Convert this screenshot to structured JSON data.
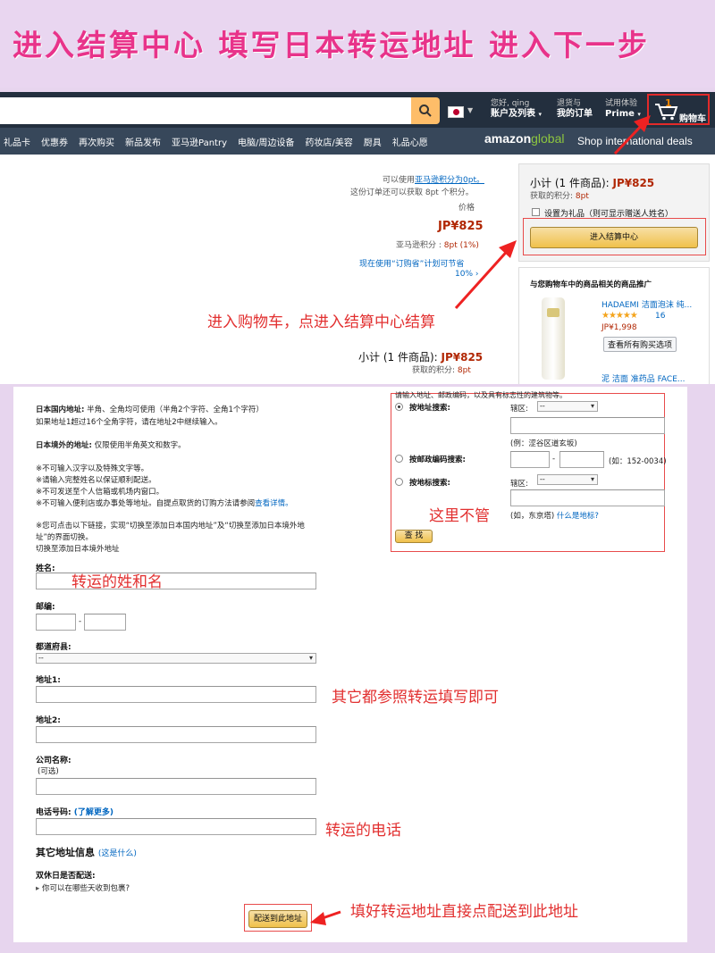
{
  "banner": {
    "title": "进入结算中心 填写日本转运地址 进入下一步"
  },
  "nav": {
    "account_greeting": "您好, qing",
    "account_label": "账户及列表",
    "orders_top": "退货与",
    "orders_label": "我的订单",
    "prime_top": "试用体验",
    "prime_label": "Prime",
    "cart_count": "1",
    "cart_label": "购物车",
    "sub_items": [
      "礼品卡",
      "优惠券",
      "再次购买",
      "新品发布",
      "亚马逊Pantry",
      "电脑/周边设备",
      "药妆店/美容",
      "厨具",
      "礼品心愿"
    ],
    "amazon_text": "amazon",
    "global_text": "global",
    "shop_intl": "Shop international deals"
  },
  "cart": {
    "points_use_text": "可以使用",
    "points_use_link": "亚马逊积分为0pt。",
    "points_earn_note": "这份订单还可以获取 8pt 个积分。",
    "price_header": "价格",
    "item_price": "JP¥825",
    "points_line": "亚马逊积分 :",
    "points_value": "8pt (1%)",
    "save_note": "现在使用“订购省”计划可节省",
    "save_pct": "10% ›",
    "subtotal_label": "小计 (1 件商品):",
    "subtotal_value": "JP¥825",
    "earn_label": "获取的积分:",
    "earn_value": "8pt"
  },
  "sidebar": {
    "subtotal_label": "小计 (1 件商品):",
    "subtotal_value": "JP¥825",
    "earn_label": "获取的积分:",
    "earn_value": "8pt",
    "gift_label": "设置为礼品（则可显示赠送人姓名）",
    "checkout_button": "进入结算中心",
    "promo_title": "与您购物车中的商品相关的商品推广",
    "promo_name": "HADAEMI 洁面泡沫 纯...",
    "promo_rating": 4.5,
    "promo_stars": "★★★★★",
    "promo_reviews": "16",
    "promo_price": "JP¥1,998",
    "promo_see_all": "查看所有购买选项",
    "promo_next": "泥 洁面 准药品 FACE..."
  },
  "annotations": {
    "cart": "进入购物车，点进入结算中心结算",
    "lookup": "这里不管",
    "name": "转运的姓和名",
    "others": "其它都参照转运填写即可",
    "phone": "转运的电话",
    "ship": "填好转运地址直接点配送到此地址"
  },
  "form": {
    "jp_addr_label": "日本国内地址:",
    "jp_addr_rule": "半角、全角均可使用（半角2个字符、全角1个字符）",
    "jp_addr_rule2": "如果地址1超过16个全角字符，请在地址2中继续输入。",
    "intl_addr_label": "日本境外的地址:",
    "intl_addr_rule": "仅限使用半角英文和数字。",
    "notes": [
      "※不可输入汉字以及特殊文字等。",
      "※请输入完整姓名以保证顺利配送。",
      "※不可发送至个人信箱或机场内窗口。",
      "※不可输入便利店或办事处等地址。自提点取货的订购方法请参阅"
    ],
    "notes_link": "查看详情。",
    "switch_note": "※您可点击以下链接，实现“切换至添加日本国内地址”及“切换至添加日本境外地",
    "switch_note2": "址”的界面切换。",
    "switch_link": "切换至添加日本境外地址",
    "name_label": "姓名:",
    "zip_label": "邮编:",
    "zip_dash": "-",
    "pref_label": "都道府县:",
    "pref_value": "--",
    "addr1_label": "地址1:",
    "addr2_label": "地址2:",
    "company_label": "公司名称:",
    "company_optional": "(可选)",
    "phone_label": "电话号码:",
    "phone_more": "(了解更多)",
    "other_info_label": "其它地址信息",
    "other_info_link": "(这是什么)",
    "weekend_label": "双休日是否配送:",
    "weekend_link": "你可以在哪些天收到包裹?",
    "ship_button": "配送到此地址"
  },
  "lookup": {
    "header": "请输入地址、邮政编码，以及具有标志性的建筑物等。",
    "by_address": "按地址搜索:",
    "ward_label": "辖区:",
    "ward_value": "--",
    "example": "(例：涩谷区道玄坂)",
    "by_zip": "按邮政编码搜索:",
    "zip_dash": "-",
    "zip_example": "(如：152-0034)",
    "by_landmark": "按地标搜索:",
    "ward_label2": "辖区:",
    "ward_value2": "--",
    "landmark_example": "(如，东京塔)",
    "landmark_link": "什么是地标?",
    "search_button": "查 找"
  }
}
